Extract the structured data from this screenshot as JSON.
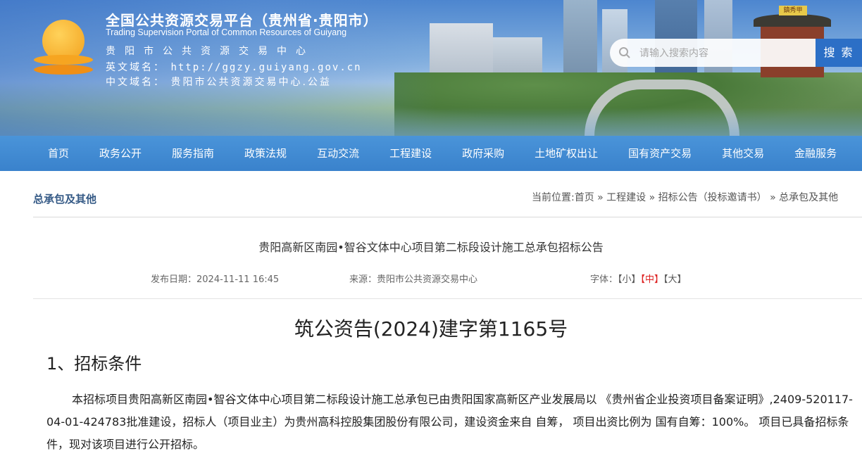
{
  "header": {
    "title": "全国公共资源交易平台（贵州省·贵阳市）",
    "subtitle_en": "Trading Supervision Portal of Common Resources of Guiyang",
    "org_name": "贵阳市公共资源交易中心",
    "en_domain_label": "英文域名：",
    "en_domain": "http://ggzy.guiyang.gov.cn",
    "cn_domain_label": "中文域名：",
    "cn_domain": "贵阳市公共资源交易中心.公益",
    "pavilion_sign": "鎮秀甲"
  },
  "search": {
    "placeholder": "请输入搜索内容",
    "button_label": "搜 索"
  },
  "nav": {
    "items": [
      "首页",
      "政务公开",
      "服务指南",
      "政策法规",
      "互动交流",
      "工程建设",
      "政府采购",
      "土地矿权出让",
      "国有资产交易",
      "其他交易",
      "金融服务"
    ]
  },
  "section": {
    "title": "总承包及其他",
    "breadcrumb": "当前位置:首页 » 工程建设 » 招标公告（投标邀请书） » 总承包及其他"
  },
  "article": {
    "title": "贵阳高新区南园•智谷文体中心项目第二标段设计施工总承包招标公告",
    "date_label": "发布日期：",
    "date": "2024-11-11 16:45",
    "source_label": "来源：",
    "source": "贵阳市公共资源交易中心",
    "font_label": "字体：",
    "font_small": "【小】",
    "font_medium": "【中】",
    "font_large": "【大】",
    "doc_number": "筑公资告(2024)建字第1165号",
    "section1_heading": "1、招标条件",
    "section1_body": "本招标项目贵阳高新区南园•智谷文体中心项目第二标段设计施工总承包已由贵阳国家高新区产业发展局以 《贵州省企业投资项目备案证明》,2409-520117-04-01-424783批准建设，招标人（项目业主）为贵州高科控股集团股份有限公司，建设资金来自 自筹， 项目出资比例为 国有自筹：100%。 项目已具备招标条件，现对该项目进行公开招标。"
  },
  "colors": {
    "nav_bg": "#3a82cc",
    "search_button": "#2c6fc6",
    "section_title": "#355a86",
    "font_active": "#dd2222"
  }
}
